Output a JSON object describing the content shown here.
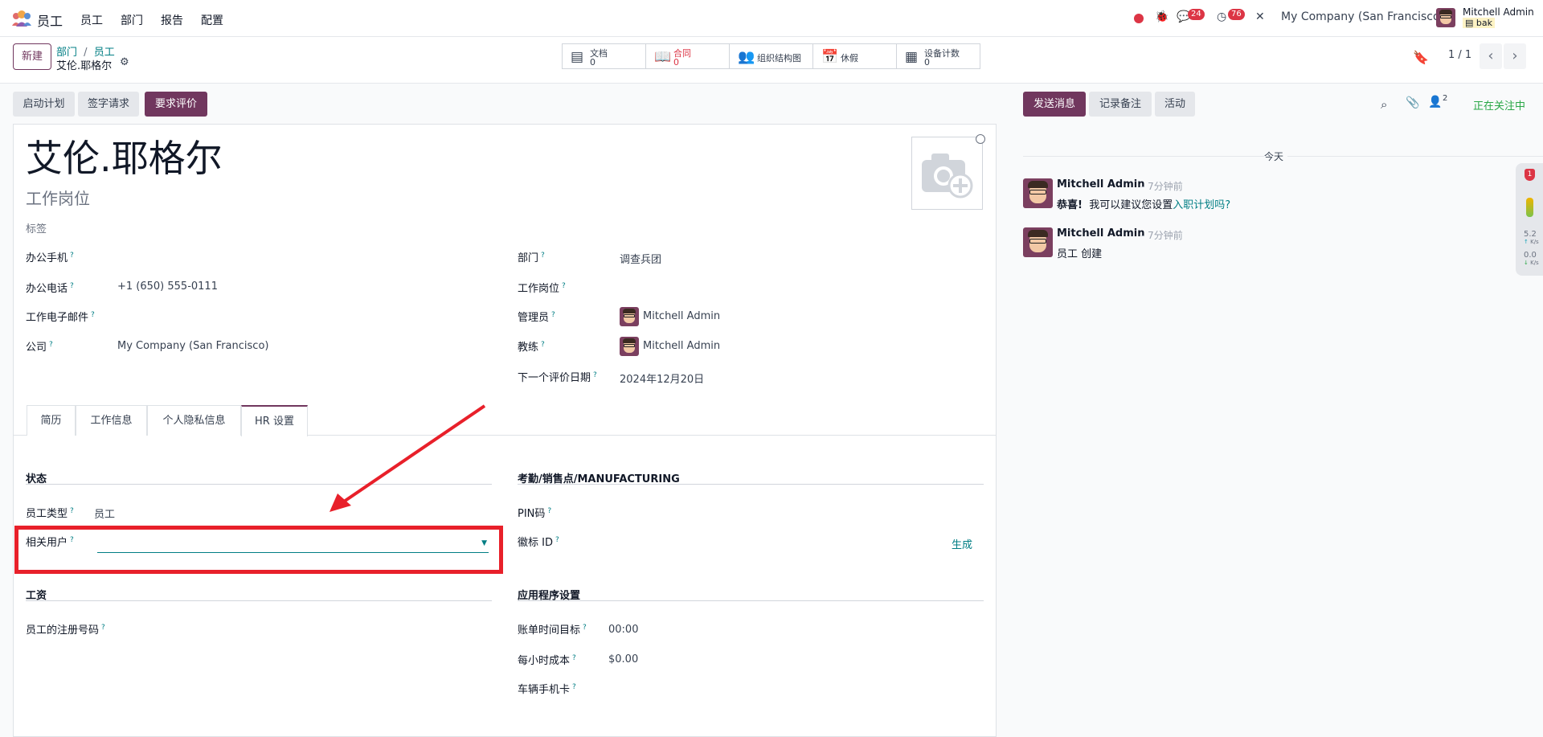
{
  "navbar": {
    "app_name": "员工",
    "menu": [
      "员工",
      "部门",
      "报告",
      "配置"
    ],
    "messages_count": "24",
    "activities_count": "76",
    "company": "My Company (San Francisco)",
    "user_name": "Mitchell Admin",
    "db_name": "bak"
  },
  "control_panel": {
    "new_label": "新建",
    "breadcrumb": [
      "部门",
      "员工"
    ],
    "record_name": "艾伦.耶格尔",
    "pager": "1 / 1"
  },
  "smart_buttons": [
    {
      "label": "文档",
      "value": "0"
    },
    {
      "label": "合同",
      "value": "0"
    },
    {
      "label": "组织结构图",
      "value": ""
    },
    {
      "label": "休假",
      "value": ""
    },
    {
      "label": "设备计数",
      "value": "0"
    }
  ],
  "status_buttons": [
    "启动计划",
    "签字请求",
    "要求评价"
  ],
  "employee": {
    "name": "艾伦.耶格尔",
    "job_position_placeholder": "工作岗位",
    "tags_placeholder": "标签"
  },
  "fields_left": [
    {
      "label": "办公手机",
      "value": ""
    },
    {
      "label": "办公电话",
      "value": "+1 (650) 555-0111"
    },
    {
      "label": "工作电子邮件",
      "value": ""
    },
    {
      "label": "公司",
      "value": "My Company (San Francisco)"
    }
  ],
  "fields_right": [
    {
      "label": "部门",
      "value": "调查兵团"
    },
    {
      "label": "工作岗位",
      "value": ""
    },
    {
      "label": "管理员",
      "value": "Mitchell Admin"
    },
    {
      "label": "教练",
      "value": "Mitchell Admin"
    },
    {
      "label": "下一个评价日期",
      "value": "2024年12月20日"
    }
  ],
  "tabs": [
    "简历",
    "工作信息",
    "个人隐私信息",
    "HR 设置"
  ],
  "hr_settings": {
    "status_title": "状态",
    "employee_type_label": "员工类型",
    "employee_type_value": "员工",
    "related_user_label": "相关用户",
    "related_user_value": "",
    "attendance_title": "考勤/销售点/MANUFACTURING",
    "pin_label": "PIN码",
    "badge_label": "徽标 ID",
    "generate_label": "生成",
    "payroll_title": "工资",
    "registration_label": "员工的注册号码",
    "app_settings_title": "应用程序设置",
    "timesheet_label": "账单时间目标",
    "timesheet_value": "00:00",
    "hourly_cost_label": "每小时成本",
    "hourly_cost_value": "$0.00",
    "vehicle_label": "车辆手机卡"
  },
  "chatter": {
    "send_label": "发送消息",
    "note_label": "记录备注",
    "activity_label": "活动",
    "followers_count": "2",
    "following_label": "正在关注中",
    "date_separator": "今天",
    "messages": [
      {
        "author": "Mitchell Admin",
        "time": "- 7分钟前",
        "body_bold": "恭喜!",
        "body": "我可以建议您设置",
        "link": "入职计划吗?"
      },
      {
        "author": "Mitchell Admin",
        "time": "- 7分钟前",
        "body_bold": "",
        "body": "员工 创建",
        "link": ""
      }
    ]
  },
  "side_widget": {
    "badge": "1",
    "up_speed": "5.2",
    "up_unit": "K/s",
    "down_speed": "0.0",
    "down_unit": "K/s"
  },
  "colors": {
    "brand": "#71375e",
    "link": "#017e84",
    "annotation": "#e8202a"
  }
}
